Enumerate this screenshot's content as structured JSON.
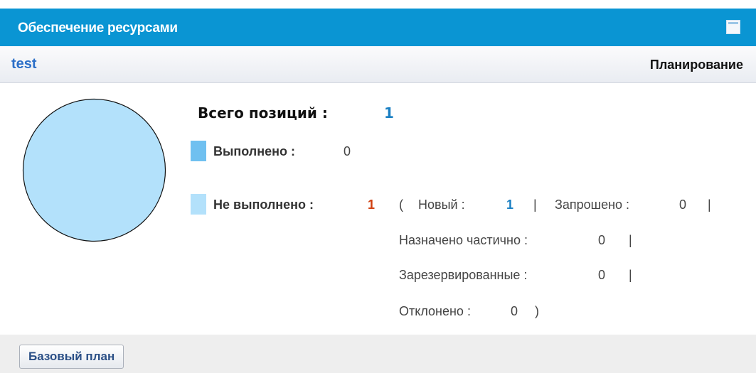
{
  "widget": {
    "title": "Обеспечение ресурсами",
    "window_icon": "maximize-window-icon"
  },
  "subheader": {
    "project_link": "test",
    "status": "Планирование"
  },
  "summary": {
    "total_label": "Всего позиций :",
    "total_value": "1",
    "done_label": "Выполнено :",
    "done_value": "0",
    "not_done_label": "Не выполнено :",
    "not_done_value": "1",
    "open_paren": "(",
    "close_paren": ")",
    "separator": "|",
    "new_label": "Новый :",
    "new_value": "1",
    "requested_label": "Запрошено :",
    "requested_value": "0",
    "partial_label": "Назначено частично :",
    "partial_value": "0",
    "reserved_label": "Зарезервированные :",
    "reserved_value": "0",
    "rejected_label": "Отклонено :",
    "rejected_value": "0"
  },
  "chart_data": {
    "type": "pie",
    "categories": [
      "Выполнено",
      "Не выполнено"
    ],
    "values": [
      0,
      1
    ],
    "colors": [
      "#6fc0f0",
      "#b3e1fb"
    ]
  },
  "footer": {
    "baseline_button": "Базовый план"
  },
  "colors": {
    "header": "#0a95d3",
    "link": "#2c6fc8",
    "total_value": "#1a7fc3",
    "not_done_value": "#d04010"
  }
}
